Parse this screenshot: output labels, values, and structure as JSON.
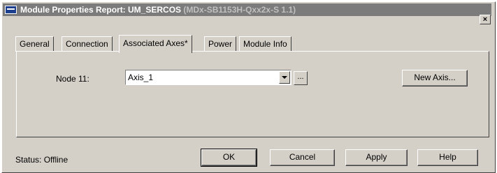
{
  "window": {
    "title": "Module Properties Report: UM_SERCOS ",
    "title_dim": "(MDx-SB1153H-Qxx2x-S 1.1)",
    "close_symbol": "×"
  },
  "tabs": [
    {
      "label": "General"
    },
    {
      "label": "Connection"
    },
    {
      "label": "Associated Axes*"
    },
    {
      "label": "Power"
    },
    {
      "label": "Module Info"
    }
  ],
  "associated_axes": {
    "node_label": "Node  11:",
    "axis_value": "Axis_1",
    "browse_label": "...",
    "new_axis_label": "New Axis..."
  },
  "footer": {
    "status": "Status:  Offline",
    "ok_label": "OK",
    "cancel_label": "Cancel",
    "apply_label": "Apply",
    "help_label": "Help"
  }
}
